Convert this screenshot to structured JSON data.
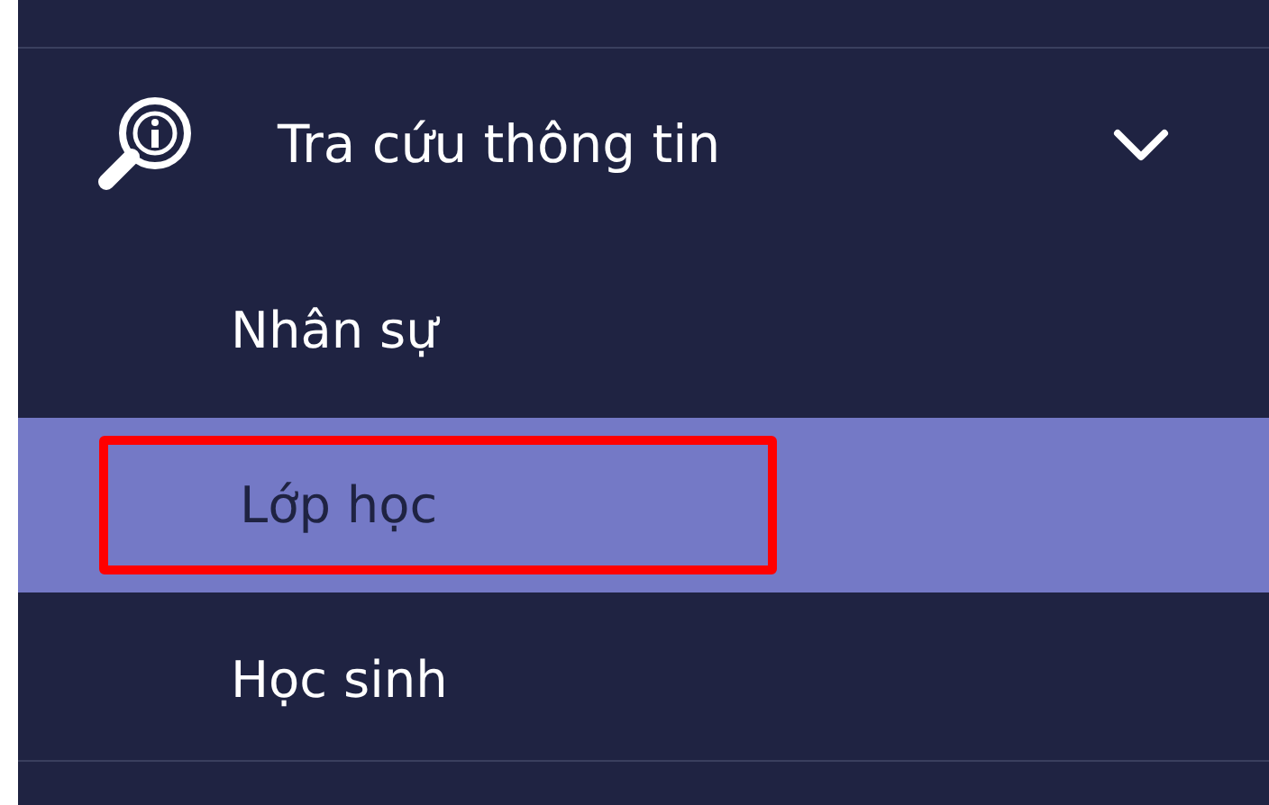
{
  "menu": {
    "title": "Tra cứu thông tin",
    "expanded": true,
    "items": [
      {
        "label": "Nhân sự",
        "selected": false,
        "highlighted": false
      },
      {
        "label": "Lớp học",
        "selected": true,
        "highlighted": true
      },
      {
        "label": "Học sinh",
        "selected": false,
        "highlighted": false
      }
    ]
  }
}
